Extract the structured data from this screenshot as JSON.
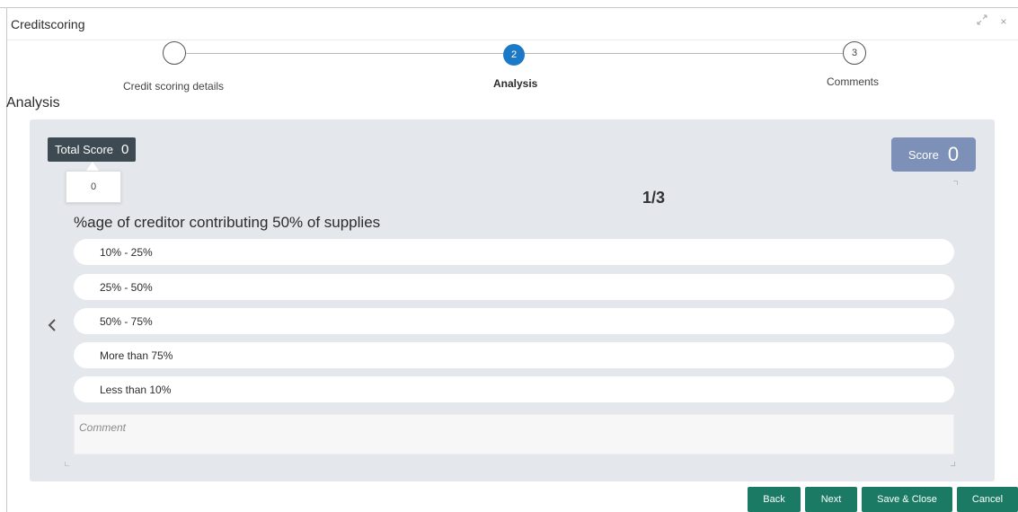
{
  "window": {
    "title": "Creditscoring",
    "controls": {
      "minimize_icon": "collapse-arrows-icon",
      "close_label": "×"
    }
  },
  "stepper": {
    "steps": [
      {
        "number": "",
        "label": "Credit scoring details",
        "state": "completed"
      },
      {
        "number": "2",
        "label": "Analysis",
        "state": "active"
      },
      {
        "number": "3",
        "label": "Comments",
        "state": "upcoming"
      }
    ],
    "active_color": "#1b79c6"
  },
  "section": {
    "title": "Analysis"
  },
  "scoring": {
    "total_score_label": "Total Score",
    "total_score_value": "0",
    "tooltip_value": "0",
    "score_label": "Score",
    "score_value": "0",
    "page_indicator": "1/3",
    "question": "%age of creditor contributing 50% of supplies",
    "options": [
      {
        "label": "10% - 25%"
      },
      {
        "label": "25% - 50%"
      },
      {
        "label": "50% - 75%"
      },
      {
        "label": "More than 75%"
      },
      {
        "label": "Less than 10%"
      }
    ],
    "comment_placeholder": "Comment",
    "prev_icon": "chevron-left-icon"
  },
  "footer": {
    "back_label": "Back",
    "next_label": "Next",
    "save_close_label": "Save & Close",
    "cancel_label": "Cancel",
    "button_color": "#1b7a64"
  },
  "colors": {
    "panel_bg": "#e4e7ec",
    "total_score_bg": "#3d4a52",
    "score_box_bg": "#7d90b8"
  }
}
